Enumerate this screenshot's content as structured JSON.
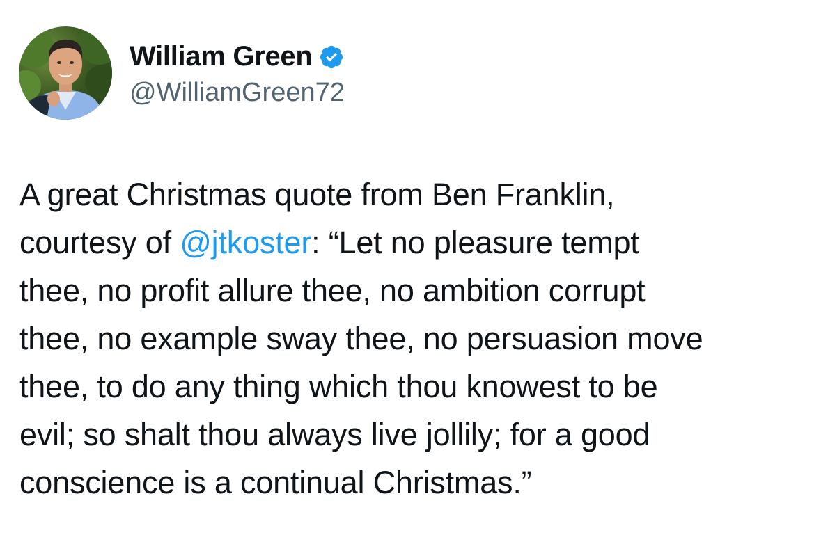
{
  "author": {
    "display_name": "William Green",
    "handle": "@WilliamGreen72",
    "verified": true,
    "verified_icon": "verified-badge-icon",
    "verified_color": "#1d9bf0"
  },
  "tweet": {
    "line1": "A great Christmas quote from Ben Franklin,",
    "line2_prefix": "courtesy of ",
    "mention": "@jtkoster",
    "line2_suffix": ": “Let no pleasure tempt",
    "line3": "thee, no profit allure thee, no ambition corrupt",
    "line4": "thee, no example sway thee, no persuasion move",
    "line5": "thee, to do any thing which thou knowest to be",
    "line6": "evil; so shalt thou always live jollily; for a good",
    "line7": "conscience is a continual Christmas.”",
    "mention_color": "#1d9bf0"
  }
}
